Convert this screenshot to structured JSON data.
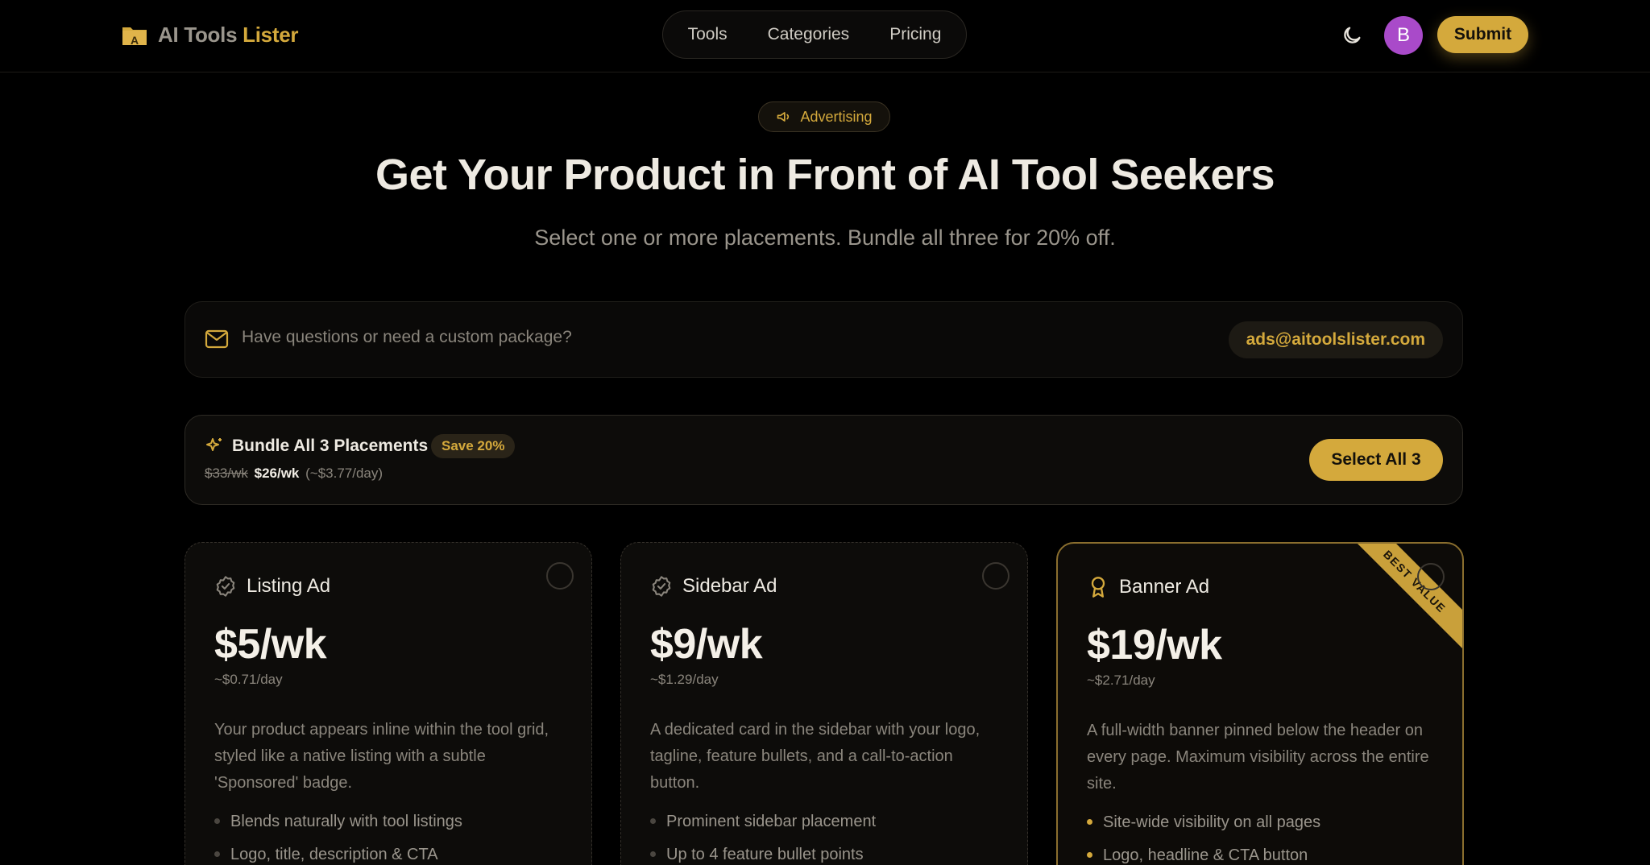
{
  "header": {
    "logo_part1": "AI Tools",
    "logo_part2": "Lister",
    "nav": [
      "Tools",
      "Categories",
      "Pricing"
    ],
    "avatar_letter": "B",
    "submit_label": "Submit",
    "theme_icon": "moon-icon"
  },
  "hero": {
    "pill_label": "Advertising",
    "pill_icon": "megaphone-icon",
    "title": "Get Your Product in Front of AI Tool Seekers",
    "subtitle": "Select one or more placements. Bundle all three for 20% off."
  },
  "contact": {
    "icon": "mail-icon",
    "question": "Have questions or need a custom package?",
    "email": "ads@aitoolslister.com"
  },
  "bundle": {
    "icon": "sparkle-icon",
    "title": "Bundle All 3 Placements",
    "badge": "Save 20%",
    "old_price": "$33/wk",
    "new_price": "$26/wk",
    "per_day": "(~$3.77/day)",
    "button": "Select All 3"
  },
  "cards": [
    {
      "icon": "check-badge-icon",
      "name": "Listing Ad",
      "price": "$5/wk",
      "per_day": "~$0.71/day",
      "description": "Your product appears inline within the tool grid, styled like a native listing with a subtle 'Sponsored' badge.",
      "features": [
        "Blends naturally with tool listings",
        "Logo, title, description & CTA"
      ]
    },
    {
      "icon": "check-badge-icon",
      "name": "Sidebar Ad",
      "price": "$9/wk",
      "per_day": "~$1.29/day",
      "description": "A dedicated card in the sidebar with your logo, tagline, feature bullets, and a call-to-action button.",
      "features": [
        "Prominent sidebar placement",
        "Up to 4 feature bullet points"
      ]
    },
    {
      "icon": "award-icon",
      "name": "Banner Ad",
      "price": "$19/wk",
      "per_day": "~$2.71/day",
      "description": "A full-width banner pinned below the header on every page. Maximum visibility across the entire site.",
      "features": [
        "Site-wide visibility on all pages",
        "Logo, headline & CTA button"
      ],
      "ribbon": "BEST VALUE"
    }
  ],
  "colors": {
    "accent": "#d4a93c",
    "background": "#000000",
    "avatar": "#a94ac9"
  }
}
